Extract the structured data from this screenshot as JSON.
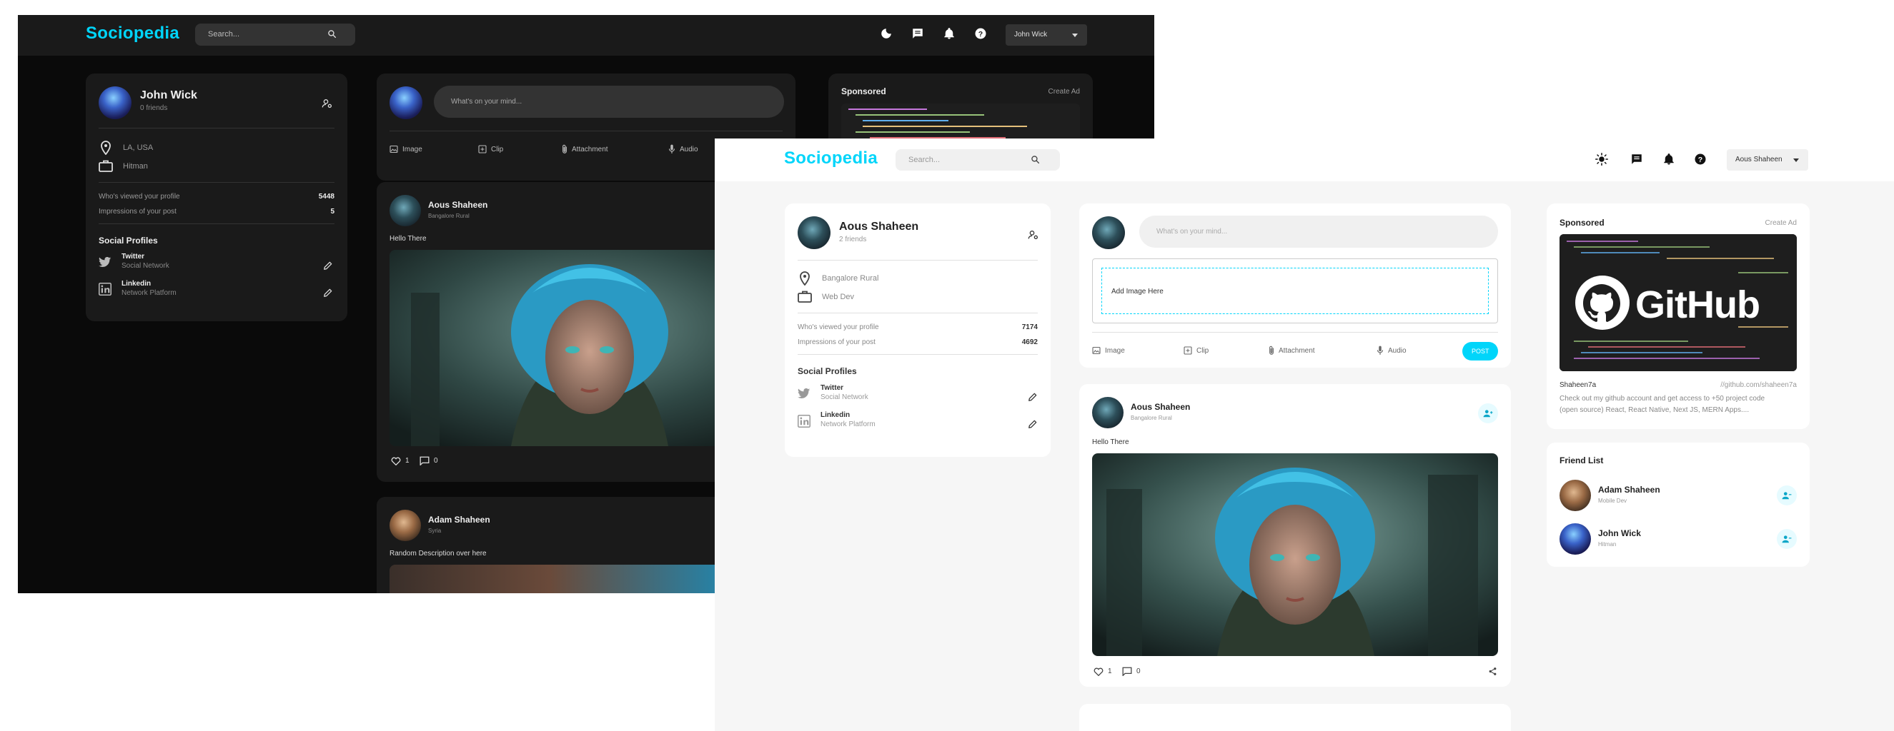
{
  "app": {
    "name": "Sociopedia"
  },
  "dark": {
    "search": {
      "placeholder": "Search..."
    },
    "user_menu": "John Wick",
    "profile": {
      "name": "John Wick",
      "friends": "0 friends",
      "location": "LA, USA",
      "occupation": "Hitman",
      "viewed_label": "Who's viewed your profile",
      "viewed_value": "5448",
      "impressions_label": "Impressions of your post",
      "impressions_value": "5",
      "social_title": "Social Profiles",
      "socials": [
        {
          "name": "Twitter",
          "type": "Social Network"
        },
        {
          "name": "Linkedin",
          "type": "Network Platform"
        }
      ]
    },
    "composer": {
      "placeholder": "What's on your mind...",
      "actions": [
        "Image",
        "Clip",
        "Attachment",
        "Audio"
      ]
    },
    "ad": {
      "title": "Sponsored",
      "create": "Create Ad"
    },
    "posts": [
      {
        "name": "Aous Shaheen",
        "location": "Bangalore Rural",
        "text": "Hello There",
        "likes": "1",
        "comments": "0"
      },
      {
        "name": "Adam Shaheen",
        "location": "Syria",
        "text": "Random Description over here"
      }
    ]
  },
  "light": {
    "search": {
      "placeholder": "Search..."
    },
    "user_menu": "Aous Shaheen",
    "profile": {
      "name": "Aous Shaheen",
      "friends": "2 friends",
      "location": "Bangalore Rural",
      "occupation": "Web Dev",
      "viewed_label": "Who's viewed your profile",
      "viewed_value": "7174",
      "impressions_label": "Impressions of your post",
      "impressions_value": "4692",
      "social_title": "Social Profiles",
      "socials": [
        {
          "name": "Twitter",
          "type": "Social Network"
        },
        {
          "name": "Linkedin",
          "type": "Network Platform"
        }
      ]
    },
    "composer": {
      "placeholder": "What's on your mind...",
      "dropzone": "Add Image Here",
      "actions": [
        "Image",
        "Clip",
        "Attachment",
        "Audio"
      ],
      "post": "POST"
    },
    "post": {
      "name": "Aous Shaheen",
      "location": "Bangalore Rural",
      "text": "Hello There",
      "likes": "1",
      "comments": "0"
    },
    "ad": {
      "title": "Sponsored",
      "create": "Create Ad",
      "image_text": "GitHub",
      "name": "Shaheen7a",
      "link": "//github.com/shaheen7a",
      "description_1": "Check out my github account and get access to +50 project code",
      "description_2": "(open source) React, React Native, Next JS, MERN Apps...."
    },
    "friends": {
      "title": "Friend List",
      "items": [
        {
          "name": "Adam Shaheen",
          "role": "Mobile Dev"
        },
        {
          "name": "John Wick",
          "role": "Hitman"
        }
      ]
    }
  },
  "colors": {
    "accent": "#00d5fa",
    "dark_bg": "#0a0a0a",
    "dark_card": "#1a1a1a",
    "light_bg": "#f6f6f6"
  }
}
